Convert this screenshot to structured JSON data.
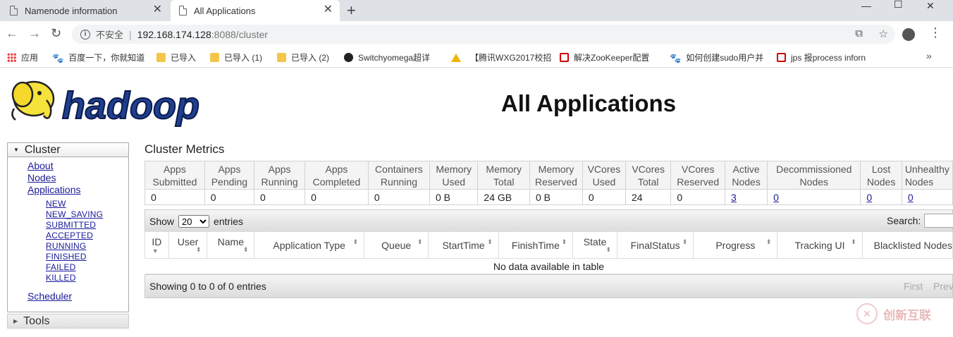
{
  "browser": {
    "tabs": [
      {
        "title": "Namenode information"
      },
      {
        "title": "All Applications"
      }
    ],
    "new_tab": "+",
    "address": {
      "security": "不安全",
      "host": "192.168.174.128",
      "path": ":8088/cluster"
    },
    "bookmarks": [
      {
        "label": "应用",
        "icon": "apps-grid-icon"
      },
      {
        "label": "百度一下，你就知道",
        "icon": "baidu-paw-icon"
      },
      {
        "label": "已导入",
        "icon": "folder-icon"
      },
      {
        "label": "已导入 (1)",
        "icon": "folder-icon"
      },
      {
        "label": "已导入 (2)",
        "icon": "folder-icon"
      },
      {
        "label": "Switchyomega超详",
        "icon": "site-icon"
      },
      {
        "label": "【腾讯WXG2017校招",
        "icon": "warning-icon"
      },
      {
        "label": "解决ZooKeeper配置",
        "icon": "csdn-icon"
      },
      {
        "label": "如何创建sudo用户并",
        "icon": "baidu-paw-icon"
      },
      {
        "label": "jps 报process inforn",
        "icon": "csdn-icon"
      }
    ]
  },
  "page": {
    "title": "All Applications",
    "logo_text": "hadoop"
  },
  "sidebar": {
    "cluster_label": "Cluster",
    "links": [
      "About",
      "Nodes",
      "Applications"
    ],
    "states": [
      "NEW",
      "NEW_SAVING",
      "SUBMITTED",
      "ACCEPTED",
      "RUNNING",
      "FINISHED",
      "FAILED",
      "KILLED"
    ],
    "scheduler": "Scheduler",
    "tools_label": "Tools"
  },
  "metrics": {
    "title": "Cluster Metrics",
    "headers": [
      [
        "Apps",
        "Submitted"
      ],
      [
        "Apps",
        "Pending"
      ],
      [
        "Apps",
        "Running"
      ],
      [
        "Apps",
        "Completed"
      ],
      [
        "Containers",
        "Running"
      ],
      [
        "Memory",
        "Used"
      ],
      [
        "Memory",
        "Total"
      ],
      [
        "Memory",
        "Reserved"
      ],
      [
        "VCores",
        "Used"
      ],
      [
        "VCores",
        "Total"
      ],
      [
        "VCores",
        "Reserved"
      ],
      [
        "Active",
        "Nodes"
      ],
      [
        "Decommissioned",
        "Nodes"
      ],
      [
        "Lost",
        "Nodes"
      ],
      [
        "Unhealthy",
        "Nodes"
      ]
    ],
    "values": [
      "0",
      "0",
      "0",
      "0",
      "0",
      "0 B",
      "24 GB",
      "0 B",
      "0",
      "24",
      "0",
      "3",
      "0",
      "0",
      "0"
    ]
  },
  "datatable": {
    "show": "Show",
    "entries_value": "20",
    "entries": "entries",
    "search": "Search:",
    "headers": [
      "ID",
      "User",
      "Name",
      "Application Type",
      "Queue",
      "StartTime",
      "FinishTime",
      "State",
      "FinalStatus",
      "Progress",
      "Tracking UI",
      "Blacklisted Nodes"
    ],
    "empty": "No data available in table",
    "info": "Showing 0 to 0 of 0 entries",
    "first": "First",
    "previous": "Previous"
  },
  "watermark": "创新互联"
}
